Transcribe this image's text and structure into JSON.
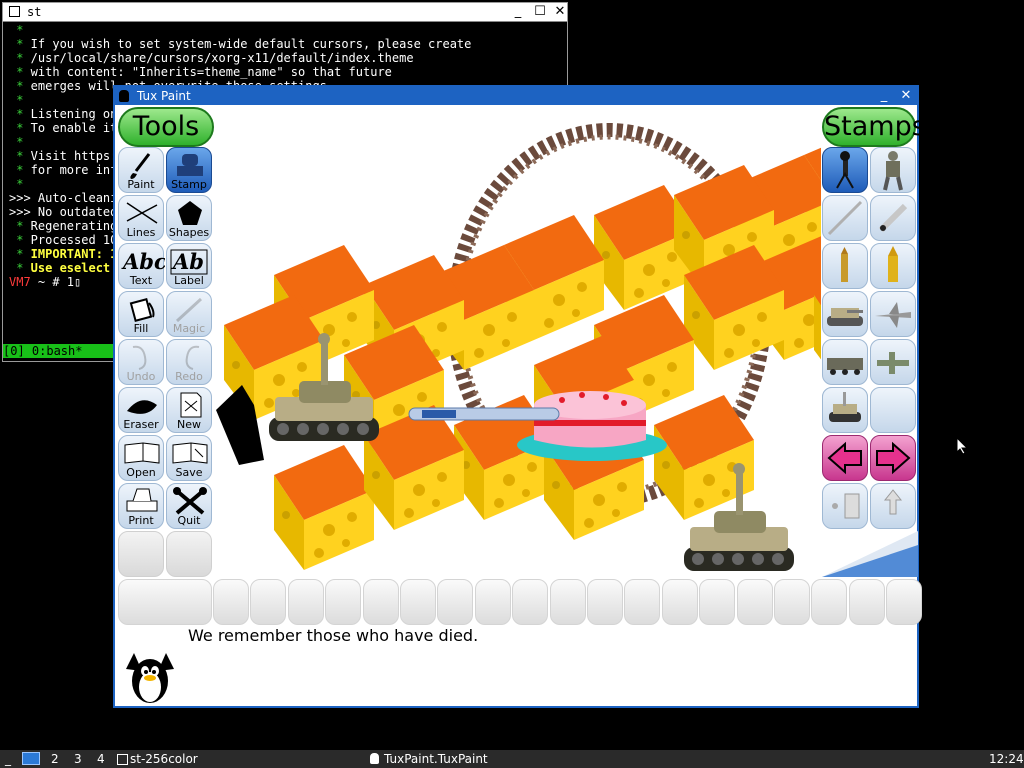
{
  "terminal": {
    "title": "st",
    "lines": [
      " * ",
      " * If you wish to set system-wide default cursors, please create",
      " * /usr/local/share/cursors/xorg-x11/default/index.theme",
      " * with content: \"Inherits=theme_name\" so that future",
      " * emerges will not overwrite those settings.",
      " * ",
      " * Listening on",
      " * To enable it",
      " * ",
      " * Visit https:",
      " * for more inf",
      " * ",
      ">>> Auto-cleani",
      "",
      ">>> No outdated",
      "",
      " * Regenerating",
      " * Processed 10",
      "",
      " * IMPORTANT: 1",
      " * Use eselect",
      "",
      "VM7 ~ # 1"
    ],
    "tmux_status": "[0] 0:bash*"
  },
  "tuxpaint": {
    "title": "Tux Paint",
    "tools_header": "Tools",
    "stamps_header": "Stamps",
    "tools": [
      {
        "label": "Paint"
      },
      {
        "label": "Stamp"
      },
      {
        "label": "Lines"
      },
      {
        "label": "Shapes"
      },
      {
        "label": "Text"
      },
      {
        "label": "Label"
      },
      {
        "label": "Fill"
      },
      {
        "label": "Magic"
      },
      {
        "label": "Undo"
      },
      {
        "label": "Redo"
      },
      {
        "label": "Eraser"
      },
      {
        "label": "New"
      },
      {
        "label": "Open"
      },
      {
        "label": "Save"
      },
      {
        "label": "Print"
      },
      {
        "label": "Quit"
      }
    ],
    "text_glyph": "Abc",
    "label_glyph": "Ab",
    "instruction": "We remember those who have died."
  },
  "taskbar": {
    "workspaces": [
      "2",
      "3",
      "4"
    ],
    "window1": "st-256color",
    "window2": "TuxPaint.TuxPaint",
    "clock": "12:24"
  }
}
